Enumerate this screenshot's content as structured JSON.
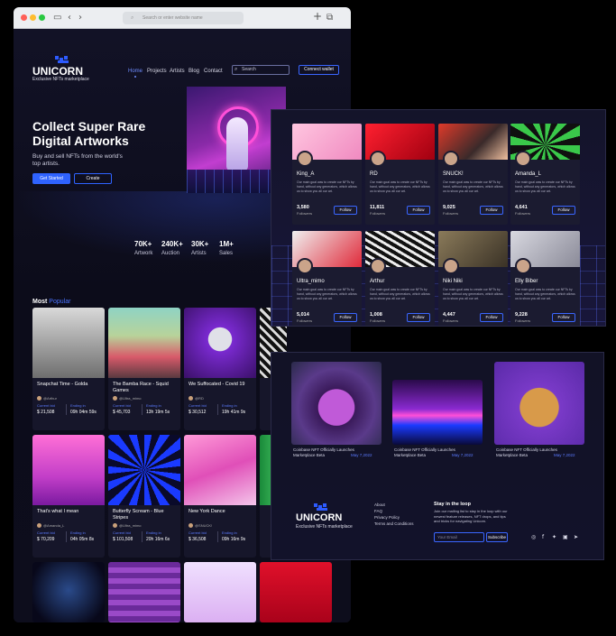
{
  "browser": {
    "address_placeholder": "Search or enter website name",
    "colors": {
      "close": "#ff5f57",
      "minimize": "#febc2e",
      "maximize": "#28c840",
      "accent": "#2f63ff"
    }
  },
  "site": {
    "logo": "UNICORN",
    "tagline": "Exclusive NFTs marketplace"
  },
  "nav": {
    "items": [
      "Home",
      "Projects",
      "Artists",
      "Blog",
      "Contact"
    ],
    "active": "Home",
    "search_placeholder": "Search",
    "connect_label": "Connect wallet"
  },
  "hero": {
    "title": "Collect Super Rare Digital Artworks",
    "subtitle": "Buy and sell NFTs from the world's top artists.",
    "get_started": "Get Started",
    "create": "Create"
  },
  "stats": [
    {
      "value": "70K+",
      "label": "Artwork"
    },
    {
      "value": "240K+",
      "label": "Auction"
    },
    {
      "value": "30K+",
      "label": "Artists"
    },
    {
      "value": "1M+",
      "label": "Sales"
    }
  ],
  "popular": {
    "title_a": "Most",
    "title_b": "Popular",
    "current_bid_label": "Current bid",
    "ending_label": "Ending in",
    "cards": [
      {
        "title": "Snapchat Time - Golda",
        "user": "@Arthur",
        "bid": "$ 21,508",
        "ends": "09h 04m 59s"
      },
      {
        "title": "The Bamba Race - Squid Games",
        "user": "@Ultra_mimo",
        "bid": "$ 45,703",
        "ends": "13h 19m 5s"
      },
      {
        "title": "We Suffocated - Covid 19",
        "user": "@RD",
        "bid": "$ 30,512",
        "ends": "19h 41m 9s"
      },
      {
        "title": "That's what I mean",
        "user": "@Amanda_L",
        "bid": "$ 70,209",
        "ends": "04h 05m 8s"
      },
      {
        "title": "Butterfly Scream - Blue Stripes",
        "user": "@Ultra_mimo",
        "bid": "$ 101,508",
        "ends": "20h 16m 6s"
      },
      {
        "title": "New York Dance",
        "user": "@SNUCK!",
        "bid": "$ 36,508",
        "ends": "09h 16m 9s"
      }
    ]
  },
  "artists": {
    "description": "Our main goal was to create our NFTs by hand, without any generators, which allows us to show you all our art.",
    "followers_label": "Followers",
    "follow_label": "Follow",
    "items": [
      {
        "name": "King_A",
        "followers": "3,580"
      },
      {
        "name": "RD",
        "followers": "11,811"
      },
      {
        "name": "SNUCK!",
        "followers": "9,025"
      },
      {
        "name": "Amanda_L",
        "followers": "4,641"
      },
      {
        "name": "Ultra_mimo",
        "followers": "5,014"
      },
      {
        "name": "Arthur",
        "followers": "1,008"
      },
      {
        "name": "Niki Niki",
        "followers": "4,447"
      },
      {
        "name": "Elly Biber",
        "followers": "9,228"
      }
    ]
  },
  "blog": {
    "posts": [
      {
        "title": "Coinbase NFT Officially Launches Marketplace Beta",
        "date": "May 7,2022"
      },
      {
        "title": "Coinbase NFT Officially Launches Marketplace Beta",
        "date": "May 7,2022"
      },
      {
        "title": "Coinbase NFT Officially Launches Marketplace Beta",
        "date": "May 7,2022"
      }
    ]
  },
  "footer": {
    "links": [
      "About",
      "FAQ",
      "Privacy Policy",
      "Terms and Conditions"
    ],
    "stay_title": "Stay in the loop",
    "stay_desc": "Join our mailing list to stay in the loop with our newest feature releases, NFT drops, and tips and tricks for navigating Unicorn.",
    "email_placeholder": "Your Email",
    "subscribe_label": "Subscribe",
    "social_icons": [
      "instagram-icon",
      "facebook-icon",
      "twitter-icon",
      "linkedin-icon",
      "telegram-icon"
    ]
  }
}
